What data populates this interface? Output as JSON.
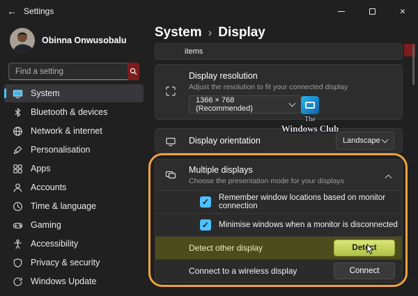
{
  "titlebar": {
    "back_icon": "←",
    "title": "Settings",
    "close_icon": "×"
  },
  "sidebar": {
    "user": {
      "name": "Obinna Onwusobalu"
    },
    "search": {
      "placeholder": "Find a setting"
    },
    "items": [
      {
        "label": "System",
        "selected": true
      },
      {
        "label": "Bluetooth & devices"
      },
      {
        "label": "Network & internet"
      },
      {
        "label": "Personalisation"
      },
      {
        "label": "Apps"
      },
      {
        "label": "Accounts"
      },
      {
        "label": "Time & language"
      },
      {
        "label": "Gaming"
      },
      {
        "label": "Accessibility"
      },
      {
        "label": "Privacy & security"
      },
      {
        "label": "Windows Update"
      }
    ]
  },
  "main": {
    "breadcrumb": {
      "root": "System",
      "separator": "›",
      "current": "Display"
    },
    "partial_row_text": "items",
    "resolution_card": {
      "title": "Display resolution",
      "subtitle": "Adjust the resolution to fit your connected display",
      "value": "1366 × 768 (Recommended)"
    },
    "orientation_card": {
      "title": "Display orientation",
      "value": "Landscape"
    },
    "multiple_displays": {
      "title": "Multiple displays",
      "subtitle": "Choose the presentation mode for your displays",
      "checkboxes": [
        {
          "label": "Remember window locations based on monitor connection",
          "checked": true
        },
        {
          "label": "Minimise windows when a monitor is disconnected",
          "checked": true
        }
      ],
      "actions": [
        {
          "label": "Detect other display",
          "button": "Detect",
          "highlighted": true
        },
        {
          "label": "Connect to a wireless display",
          "button": "Connect",
          "highlighted": false
        }
      ]
    },
    "watermark": {
      "line1": "The",
      "line2": "Windows Club"
    }
  },
  "glyphs": {
    "check": "✓"
  },
  "colors": {
    "accent": "#4cc2ff",
    "annotation": "#f1a33a",
    "highlight_row": "#4b4d1c",
    "red_fragment": "#7e1d1d"
  }
}
